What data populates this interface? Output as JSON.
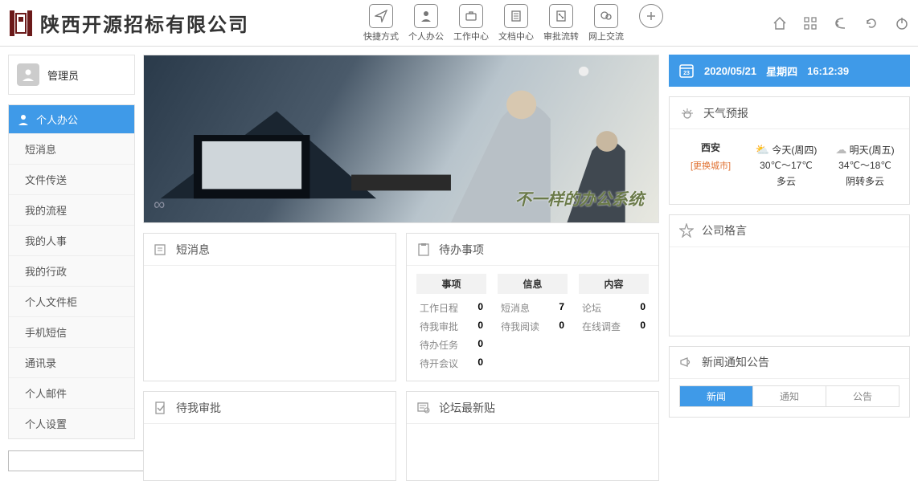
{
  "header": {
    "company": "陕西开源招标有限公司",
    "nav": [
      {
        "label": "快捷方式",
        "icon": "send"
      },
      {
        "label": "个人办公",
        "icon": "person"
      },
      {
        "label": "工作中心",
        "icon": "briefcase"
      },
      {
        "label": "文档中心",
        "icon": "doc"
      },
      {
        "label": "审批流转",
        "icon": "flow"
      },
      {
        "label": "网上交流",
        "icon": "chat"
      }
    ]
  },
  "user": {
    "name": "管理员"
  },
  "menu": {
    "head": "个人办公",
    "items": [
      "短消息",
      "文件传送",
      "我的流程",
      "我的人事",
      "我的行政",
      "个人文件柜",
      "手机短信",
      "通讯录",
      "个人邮件",
      "个人设置"
    ]
  },
  "search": {
    "placeholder": ""
  },
  "banner": {
    "slogan": "不一样的办公系统"
  },
  "cards": {
    "sms": {
      "title": "短消息"
    },
    "todo": {
      "title": "待办事项",
      "cols": [
        "事项",
        "信息",
        "内容"
      ],
      "rows": {
        "c1": [
          {
            "label": "工作日程",
            "val": "0"
          },
          {
            "label": "待我审批",
            "val": "0"
          },
          {
            "label": "待办任务",
            "val": "0"
          },
          {
            "label": "待开会议",
            "val": "0"
          }
        ],
        "c2": [
          {
            "label": "短消息",
            "val": "7"
          },
          {
            "label": "待我阅读",
            "val": "0"
          }
        ],
        "c3": [
          {
            "label": "论坛",
            "val": "0"
          },
          {
            "label": "在线调查",
            "val": "0"
          }
        ]
      }
    },
    "approval": {
      "title": "待我审批"
    },
    "forum": {
      "title": "论坛最新贴"
    },
    "motto": {
      "title": "公司格言"
    },
    "weather": {
      "title": "天气预报"
    },
    "news": {
      "title": "新闻通知公告",
      "tabs": [
        "新闻",
        "通知",
        "公告"
      ],
      "active": 0
    }
  },
  "datetime": {
    "date": "2020/05/21",
    "weekday": "星期四",
    "time": "16:12:39"
  },
  "weather": {
    "city": "西安",
    "change": "[更换城市]",
    "days": [
      {
        "name": "今天(周四)",
        "range": "30℃～17℃",
        "cond": "多云"
      },
      {
        "name": "明天(周五)",
        "range": "34℃～18℃",
        "cond": "阴转多云"
      }
    ]
  }
}
